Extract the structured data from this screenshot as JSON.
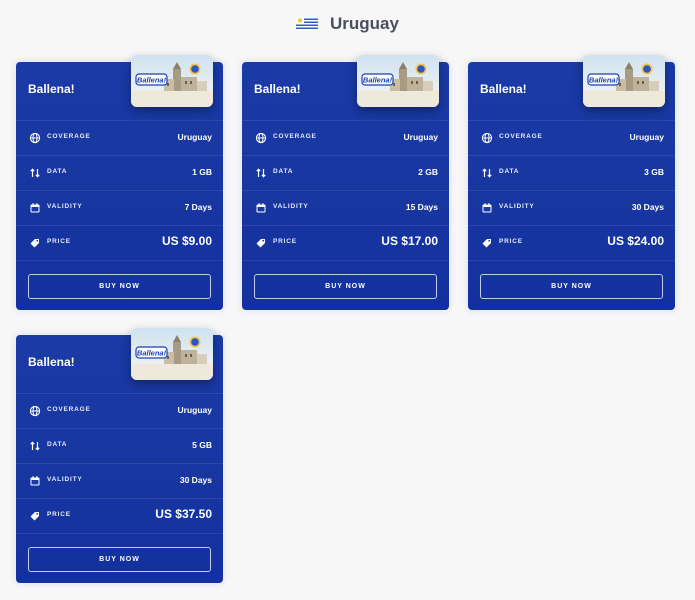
{
  "page": {
    "country": "Uruguay",
    "flag_icon": "uruguay-flag-icon"
  },
  "labels": {
    "coverage": "COVERAGE",
    "data": "DATA",
    "validity": "VALIDITY",
    "price": "PRICE",
    "buy": "BUY NOW"
  },
  "icons": {
    "coverage": "globe-icon",
    "data": "transfer-arrows-icon",
    "validity": "calendar-icon",
    "price": "price-tag-icon"
  },
  "colors": {
    "card": "#1a3aa6",
    "background": "#f7f7f8",
    "title": "#4a4f5c"
  },
  "plans": [
    {
      "operator": "Ballena!",
      "coverage": "Uruguay",
      "data": "1 GB",
      "validity": "7 Days",
      "price": "US $9.00"
    },
    {
      "operator": "Ballena!",
      "coverage": "Uruguay",
      "data": "2 GB",
      "validity": "15 Days",
      "price": "US $17.00"
    },
    {
      "operator": "Ballena!",
      "coverage": "Uruguay",
      "data": "3 GB",
      "validity": "30 Days",
      "price": "US $24.00"
    },
    {
      "operator": "Ballena!",
      "coverage": "Uruguay",
      "data": "5 GB",
      "validity": "30 Days",
      "price": "US $37.50"
    }
  ]
}
